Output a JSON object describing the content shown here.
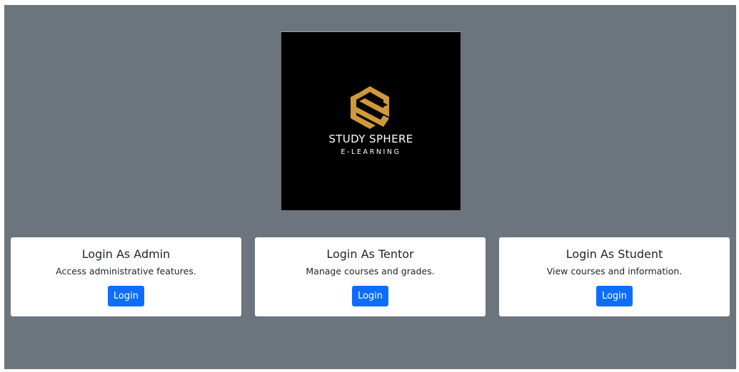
{
  "logo": {
    "icon": "study-sphere-s-logo-icon",
    "title": "STUDY SPHERE",
    "subtitle": "E-LEARNING",
    "accent_color": "#d09a3b"
  },
  "cards": [
    {
      "title": "Login As Admin",
      "description": "Access administrative features.",
      "button_label": "Login"
    },
    {
      "title": "Login As Tentor",
      "description": "Manage courses and grades.",
      "button_label": "Login"
    },
    {
      "title": "Login As Student",
      "description": "View courses and information.",
      "button_label": "Login"
    }
  ],
  "colors": {
    "background": "#6c757d",
    "card": "#ffffff",
    "button": "#0d6efd"
  }
}
